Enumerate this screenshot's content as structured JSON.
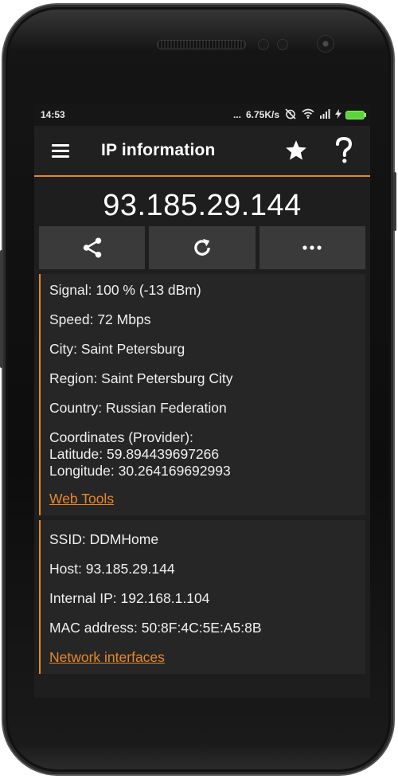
{
  "status_bar": {
    "time": "14:53",
    "dots": "...",
    "speed": "6.75K/s"
  },
  "app_bar": {
    "title": "IP information"
  },
  "ip_address": "93.185.29.144",
  "location_card": {
    "signal": "Signal: 100 % (-13 dBm)",
    "speed": "Speed: 72 Mbps",
    "city": "City: Saint Petersburg",
    "region": "Region: Saint Petersburg City",
    "country": "Country: Russian Federation",
    "coordinates_label": "Coordinates (Provider):",
    "latitude": "Latitude: 59.894439697266",
    "longitude": "Longitude: 30.264169692993",
    "link": "Web Tools"
  },
  "network_card": {
    "ssid": "SSID: DDMHome",
    "host": "Host: 93.185.29.144",
    "internal_ip": "Internal IP: 192.168.1.104",
    "mac": "MAC address: 50:8F:4C:5E:A5:8B",
    "link": "Network interfaces"
  },
  "colors": {
    "accent": "#e8872a",
    "background": "#1e1e1e",
    "card": "#262626",
    "button": "#3a3a3a",
    "battery": "#5bd63a"
  },
  "icons": {
    "menu": "hamburger-icon",
    "favorite": "star-icon",
    "help": "question-icon",
    "share": "share-icon",
    "refresh": "refresh-icon",
    "more": "more-dots-icon",
    "no_alarm": "alarm-off-icon",
    "wifi": "wifi-icon",
    "signal": "signal-bars-icon",
    "charging": "bolt-icon",
    "battery": "battery-icon"
  }
}
